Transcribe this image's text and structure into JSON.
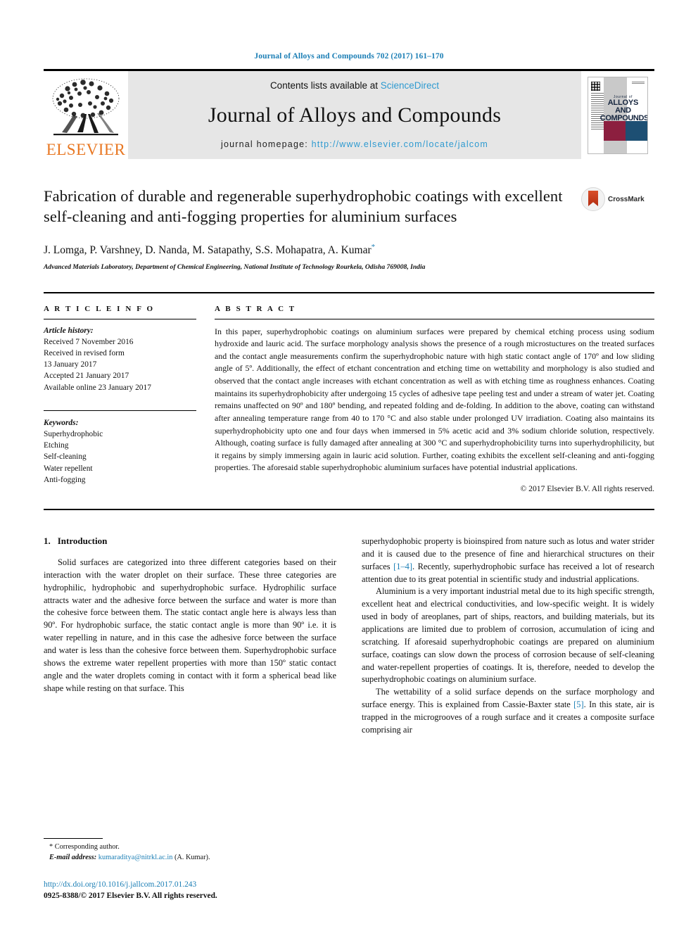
{
  "running_head": "Journal of Alloys and Compounds 702 (2017) 161–170",
  "masthead": {
    "contents_prefix": "Contents lists available at ",
    "sciencedirect": "ScienceDirect",
    "journal_name": "Journal of Alloys and Compounds",
    "homepage_label": "journal homepage: ",
    "homepage_url": "http://www.elsevier.com/locate/jalcom",
    "publisher": "ELSEVIER",
    "cover": {
      "journal_of": "Journal of",
      "alloys": "ALLOYS",
      "and_compounds": "AND COMPOUNDS"
    }
  },
  "article": {
    "title": "Fabrication of durable and regenerable superhydrophobic coatings with excellent self-cleaning and anti-fogging properties for aluminium surfaces",
    "authors": "J. Lomga, P. Varshney, D. Nanda, M. Satapathy, S.S. Mohapatra, A. Kumar",
    "corresponding_marker": "*",
    "affiliation": "Advanced Materials Laboratory, Department of Chemical Engineering, National Institute of Technology Rourkela, Odisha 769008, India",
    "crossmark_label": "CrossMark"
  },
  "article_info": {
    "heading": "A R T I C L E   I N F O",
    "history_label": "Article history:",
    "history": [
      "Received 7 November 2016",
      "Received in revised form",
      "13 January 2017",
      "Accepted 21 January 2017",
      "Available online 23 January 2017"
    ],
    "keywords_label": "Keywords:",
    "keywords": [
      "Superhydrophobic",
      "Etching",
      "Self-cleaning",
      "Water repellent",
      "Anti-fogging"
    ]
  },
  "abstract": {
    "heading": "A B S T R A C T",
    "text": "In this paper, superhydrophobic coatings on aluminium surfaces were prepared by chemical etching process using sodium hydroxide and lauric acid. The surface morphology analysis shows the presence of a rough microstuctures on the treated surfaces and the contact angle measurements confirm the superhydrophobic nature with high static contact angle of 170º and low sliding angle of 5º. Additionally, the effect of etchant concentration and etching time on wettability and morphology is also studied and observed that the contact angle increases with etchant concentration as well as with etching time as roughness enhances. Coating maintains its superhydrophobicity after undergoing 15 cycles of adhesive tape peeling test and under a stream of water jet. Coating remains unaffected on 90º and 180º bending, and repeated folding and de-folding. In addition to the above, coating can withstand after annealing temperature range from 40 to 170 °C and also stable under prolonged UV irradiation. Coating also maintains its superhydrophobicity upto one and four days when immersed in 5% acetic acid and 3% sodium chloride solution, respectively. Although, coating surface is fully damaged after annealing at 300 °C and superhydrophobicility turns into superhydrophilicity, but it regains by simply immersing again in lauric acid solution. Further, coating exhibits the excellent self-cleaning and anti-fogging properties. The aforesaid stable superhydrophobic aluminium surfaces have potential industrial applications.",
    "copyright": "© 2017 Elsevier B.V. All rights reserved."
  },
  "introduction": {
    "number": "1.",
    "heading": "Introduction",
    "para1_left": "Solid surfaces are categorized into three different categories based on their interaction with the water droplet on their surface. These three categories are hydrophilic, hydrophobic and superhydrophobic surface. Hydrophilic surface attracts water and the adhesive force between the surface and water is more than the cohesive force between them. The static contact angle here is always less than 90º. For hydrophobic surface, the static contact angle is more than 90º i.e. it is water repelling in nature, and in this case the adhesive force between the surface and water is less than the cohesive force between them. Superhydrophobic surface shows the extreme water repellent properties with more than 150º static contact angle and the water droplets coming in contact with it form a spherical bead like shape while resting on that surface. This",
    "para1_right_continued": "superhydophobic property is bioinspired from nature such as lotus and water strider and it is caused due to the presence of fine and hierarchical structures on their surfaces ",
    "cite_1_4": "[1–4]",
    "para1_right_tail": ". Recently, superhydrophobic surface has received a lot of research attention due to its great potential in scientific study and industrial applications.",
    "para2_right": "Aluminium is a very important industrial metal due to its high specific strength, excellent heat and electrical conductivities, and low-specific weight. It is widely used in body of areoplanes, part of ships, reactors, and building materials, but its applications are limited due to problem of corrosion, accumulation of icing and scratching. If aforesaid superhydrophobic coatings are prepared on aluminium surface, coatings can slow down the process of corrosion because of self-cleaning and water-repellent properties of coatings. It is, therefore, needed to develop the superhydrophobic coatings on aluminium surface.",
    "para3_right_head": "The wettability of a solid surface depends on the surface morphology and surface energy. This is explained from Cassie-Baxter state ",
    "cite_5": "[5]",
    "para3_right_tail": ". In this state, air is trapped in the microgrooves of a rough surface and it creates a composite surface comprising air"
  },
  "footnote": {
    "corresponding": "* Corresponding author.",
    "email_label": "E-mail address:",
    "email": "kumaraditya@nitrkl.ac.in",
    "email_suffix": "(A. Kumar)."
  },
  "footer": {
    "doi": "http://dx.doi.org/10.1016/j.jallcom.2017.01.243",
    "issn_line": "0925-8388/© 2017 Elsevier B.V. All rights reserved."
  },
  "colors": {
    "link": "#1b7eb5",
    "sciencedirect": "#2e9ad0",
    "elsevier_orange": "#E87722",
    "masthead_gray": "#e6e6e6",
    "cover_maroon": "#8c1f3f",
    "cover_blue": "#1d4f73"
  }
}
